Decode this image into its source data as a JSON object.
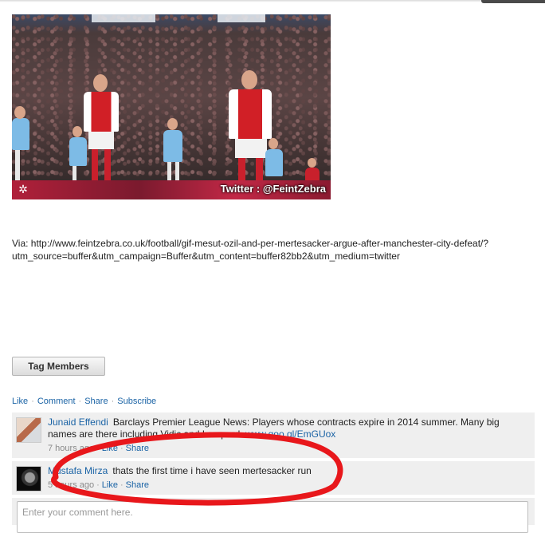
{
  "media": {
    "watermark": "Twitter : @FeintZebra",
    "logo_icon": "zebra-logo-icon"
  },
  "post": {
    "via_prefix": "Via: ",
    "via_url": "http://www.feintzebra.co.uk/football/gif-mesut-ozil-and-per-mertesacker-argue-after-manchester-city-defeat/?utm_source=buffer&utm_campaign=Buffer&utm_content=buffer82bb2&utm_medium=twitter"
  },
  "tag_button": {
    "label": "Tag Members"
  },
  "actions": {
    "like": "Like",
    "comment": "Comment",
    "share": "Share",
    "subscribe": "Subscribe",
    "separator": "·"
  },
  "comments": [
    {
      "author": "Junaid Effendi",
      "text_before": "Barclays Premier League News: Players whose contracts expire in 2014 summer. Many big names are there including Vidic and Lampard. ",
      "link": "www.goo.gl/EmGUox",
      "time": "7 hours ago",
      "like": "Like",
      "share": "Share"
    },
    {
      "author": "Mustafa Mirza",
      "text_before": "thats the first time i have seen mertesacker run",
      "link": "",
      "time": "5 hours ago",
      "like": "Like",
      "share": "Share"
    }
  ],
  "comment_input": {
    "placeholder": "Enter your comment here."
  },
  "colors": {
    "link": "#1a63a5",
    "comment_bg": "#efefef",
    "annotation": "#e8171b"
  }
}
